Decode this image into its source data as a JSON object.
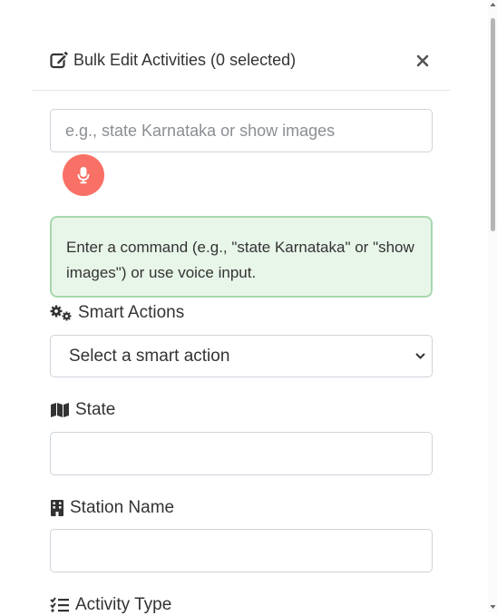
{
  "modal": {
    "title": "Bulk Edit Activities (0 selected)",
    "close_label": "×"
  },
  "command": {
    "placeholder": "e.g., state Karnataka or show images",
    "value": ""
  },
  "info_text": "Enter a command (e.g., \"state Karnataka\" or \"show images\") or use voice input.",
  "smart_actions": {
    "label": "Smart Actions",
    "selected": "Select a smart action"
  },
  "state": {
    "label": "State",
    "value": ""
  },
  "station": {
    "label": "Station Name",
    "value": ""
  },
  "activity_type": {
    "label": "Activity Type"
  },
  "icons": {
    "title": "edit-icon",
    "mic": "microphone-icon",
    "smart": "cogs-icon",
    "state": "map-icon",
    "station": "building-icon",
    "activity": "list-check-icon"
  },
  "colors": {
    "mic_button": "#f97066",
    "info_bg": "#e8f5e9",
    "info_border": "#a7d8ad"
  }
}
